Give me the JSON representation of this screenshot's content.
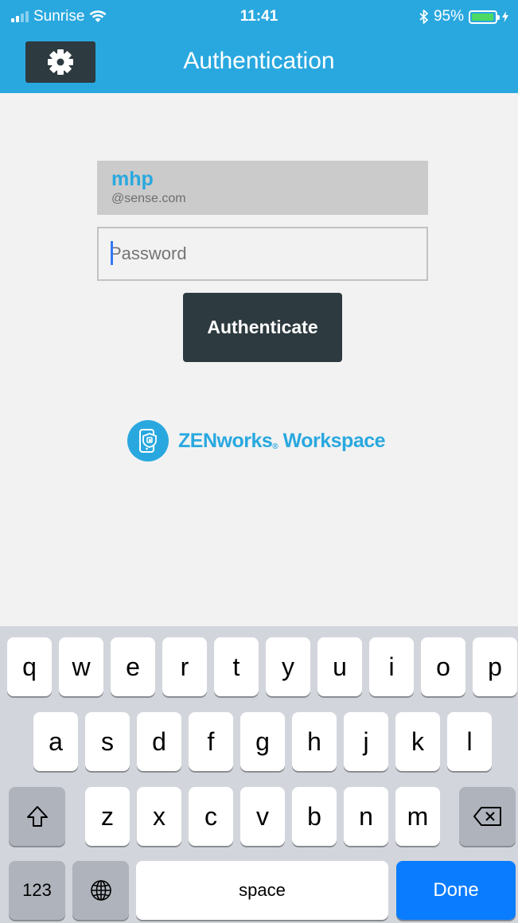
{
  "status_bar": {
    "carrier": "Sunrise",
    "time": "11:41",
    "battery": "95%",
    "battery_level": 0.95
  },
  "nav": {
    "title": "Authentication",
    "settings_icon": "gear-icon"
  },
  "login": {
    "username": "mhp",
    "domain": "@sense.com",
    "password_placeholder": "Password",
    "password_value": "",
    "authenticate_label": "Authenticate"
  },
  "brand": {
    "logo_icon": "zenworks-logo-icon",
    "name_part1": "ZENworks",
    "name_part2": "Workspace"
  },
  "colors": {
    "accent": "#29a8df",
    "dark_button": "#2d3a40",
    "done_key": "#0a7cff",
    "battery": "#4cd964"
  },
  "keyboard": {
    "row1": [
      "q",
      "w",
      "e",
      "r",
      "t",
      "y",
      "u",
      "i",
      "o",
      "p"
    ],
    "row2": [
      "a",
      "s",
      "d",
      "f",
      "g",
      "h",
      "j",
      "k",
      "l"
    ],
    "row3": [
      "z",
      "x",
      "c",
      "v",
      "b",
      "n",
      "m"
    ],
    "numbers_label": "123",
    "space_label": "space",
    "done_label": "Done"
  }
}
